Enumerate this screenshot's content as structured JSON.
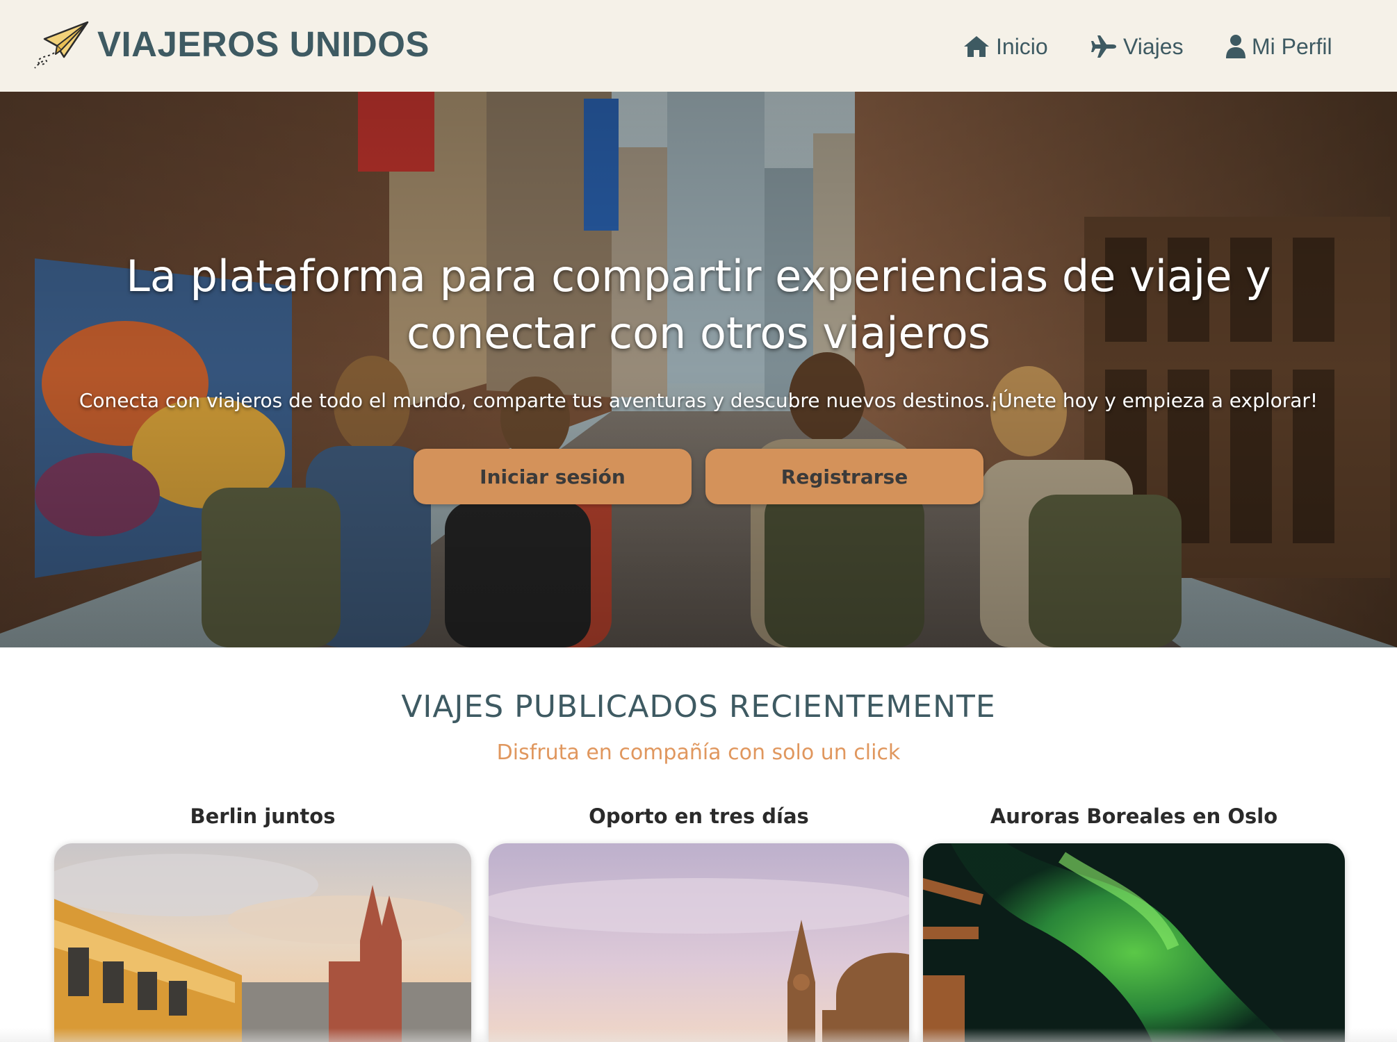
{
  "header": {
    "brand": "VIAJEROS UNIDOS",
    "nav": [
      {
        "label": "Inicio",
        "icon": "home-icon"
      },
      {
        "label": "Viajes",
        "icon": "plane-icon"
      },
      {
        "label": "Mi Perfil",
        "icon": "user-icon"
      }
    ]
  },
  "hero": {
    "title": "La plataforma para compartir experiencias de viaje y conectar con otros viajeros",
    "subtitle": "Conecta con viajeros de todo el mundo, comparte tus aventuras y descubre nuevos destinos.¡Únete hoy y empieza a explorar!",
    "login_label": "Iniciar sesión",
    "register_label": "Registrarse"
  },
  "section": {
    "title": "VIAJES PUBLICADOS RECIENTEMENTE",
    "subtitle": "Disfruta en compañía con solo un click"
  },
  "trips": [
    {
      "title": "Berlin juntos"
    },
    {
      "title": "Oporto en tres días"
    },
    {
      "title": "Auroras Boreales en Oslo"
    }
  ],
  "colors": {
    "header_bg": "#f5f1e8",
    "brand": "#3e5a62",
    "accent_button": "#d4925a",
    "subtitle_orange": "#e0975e"
  }
}
